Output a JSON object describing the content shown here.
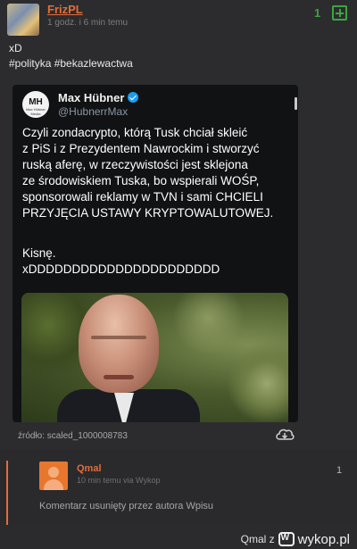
{
  "post": {
    "author": "FrizPL",
    "timestamp": "1 godz. i 6 min temu",
    "votes": "1",
    "text": "xD",
    "tags": "#polityka #bekazlewactwa",
    "source_label": "źródło: scaled_1000008783"
  },
  "tweet": {
    "avatar_text": "MH",
    "avatar_subtext": "Max Hübner Media",
    "name": "Max Hübner",
    "handle": "@HubnerrMax",
    "lines": [
      "Czyli zondacrypto, którą Tusk chciał skleić",
      "z PiS i z Prezydentem Nawrockim i stworzyć",
      "ruską aferę, w rzeczywistości jest sklejona",
      "ze środowiskiem Tuska, bo wspierali WOŚP,",
      "sponsorowali reklamy w TVN i sami CHCIELI",
      "PRZYJĘCIA USTAWY KRYPTOWALUTOWEJ."
    ],
    "line2": "Kisnę.",
    "line3": "xDDDDDDDDDDDDDDDDDDDDDD"
  },
  "comment": {
    "author": "Qmal",
    "time": "10 min temu  via Wykop",
    "votes": "1",
    "text": "Komentarz usunięty przez autora Wpisu"
  },
  "watermark": {
    "user": "Qmal z",
    "brand": "wykop.pl"
  },
  "colors": {
    "accent": "#e36c3a",
    "vote_green": "#3aa640",
    "verified_blue": "#1d9bf0"
  }
}
